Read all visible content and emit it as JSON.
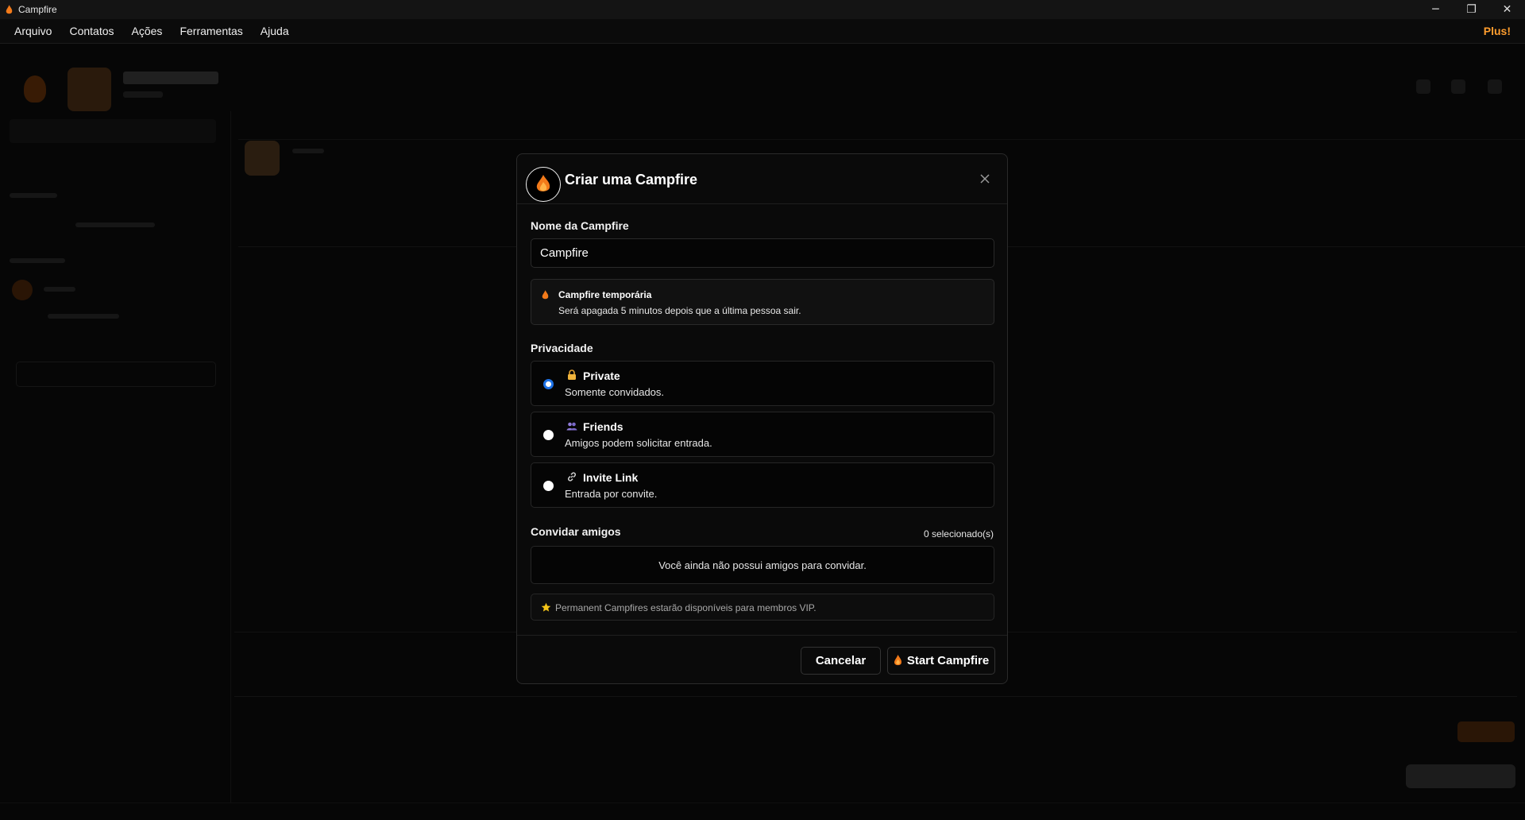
{
  "window": {
    "title": "Campfire",
    "controls": {
      "minimize": "─",
      "restore": "❐",
      "close": "✕"
    }
  },
  "menu": {
    "items": [
      "Arquivo",
      "Contatos",
      "Ações",
      "Ferramentas",
      "Ajuda"
    ],
    "plus_label": "Plus!"
  },
  "modal": {
    "title": "Criar uma Campfire",
    "name_label": "Nome da Campfire",
    "name_value": "Campfire",
    "temporary": {
      "title": "Campfire temporária",
      "description": "Será apagada 5 minutos depois que a última pessoa sair."
    },
    "privacy_label": "Privacidade",
    "privacy_options": [
      {
        "title": "Private",
        "description": "Somente convidados.",
        "icon": "lock-icon",
        "checked": true
      },
      {
        "title": "Friends",
        "description": "Amigos podem solicitar entrada.",
        "icon": "people-icon",
        "checked": false
      },
      {
        "title": "Invite Link",
        "description": "Entrada por convite.",
        "icon": "link-icon",
        "checked": false
      }
    ],
    "invite_label": "Convidar amigos",
    "selected_count": "0 selecionado(s)",
    "empty_friends": "Você ainda não possui amigos para convidar.",
    "vip_note": "Permanent Campfires estarão disponíveis para membros VIP.",
    "cancel_label": "Cancelar",
    "start_label": "Start Campfire"
  },
  "colors": {
    "accent": "#ff9d2e",
    "radio_checked": "#1e72e6",
    "flame": "#f27a1a"
  }
}
